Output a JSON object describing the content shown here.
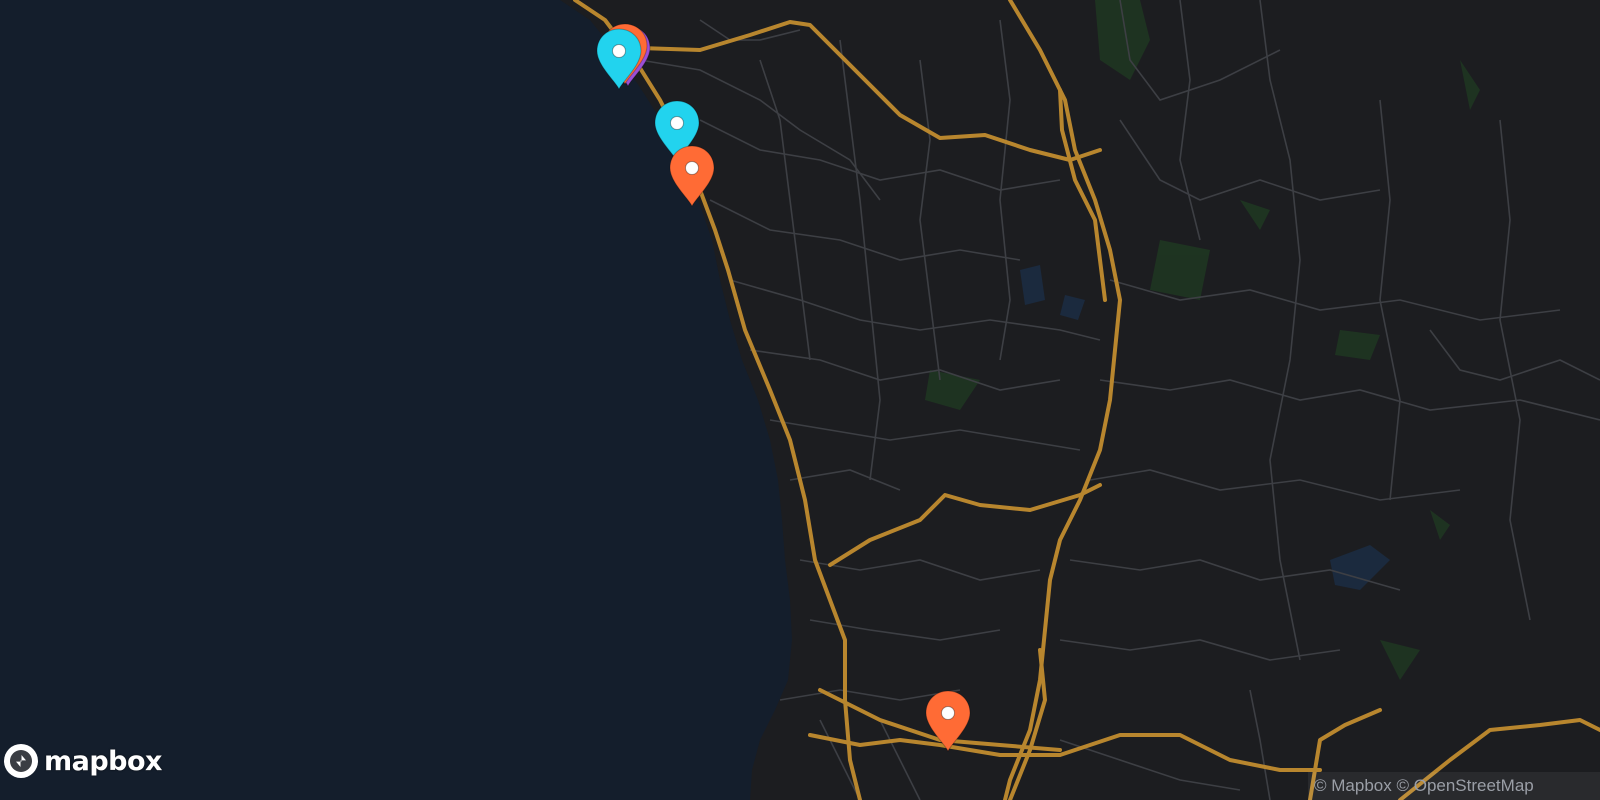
{
  "map": {
    "water_color": "#141e2c",
    "land_color": "#1c1d20",
    "highway_color": "#b8862e",
    "street_color": "#3d3f44",
    "park_color": "#1f3a22"
  },
  "markers": [
    {
      "id": "m1",
      "color": "#9c4fd6",
      "icon": "map-pin-icon"
    },
    {
      "id": "m2",
      "color": "#ff6b35",
      "icon": "map-pin-icon"
    },
    {
      "id": "m3",
      "color": "#22d3ee",
      "icon": "map-pin-icon"
    },
    {
      "id": "m4",
      "color": "#22d3ee",
      "icon": "map-pin-icon"
    },
    {
      "id": "m5",
      "color": "#ff6b35",
      "icon": "map-pin-icon"
    },
    {
      "id": "m6",
      "color": "#ff6b35",
      "icon": "map-pin-icon"
    }
  ],
  "logo": {
    "text": "mapbox",
    "icon": "mapbox-logo-icon"
  },
  "attribution": {
    "mapbox": "© Mapbox",
    "osm": "© OpenStreetMap"
  }
}
